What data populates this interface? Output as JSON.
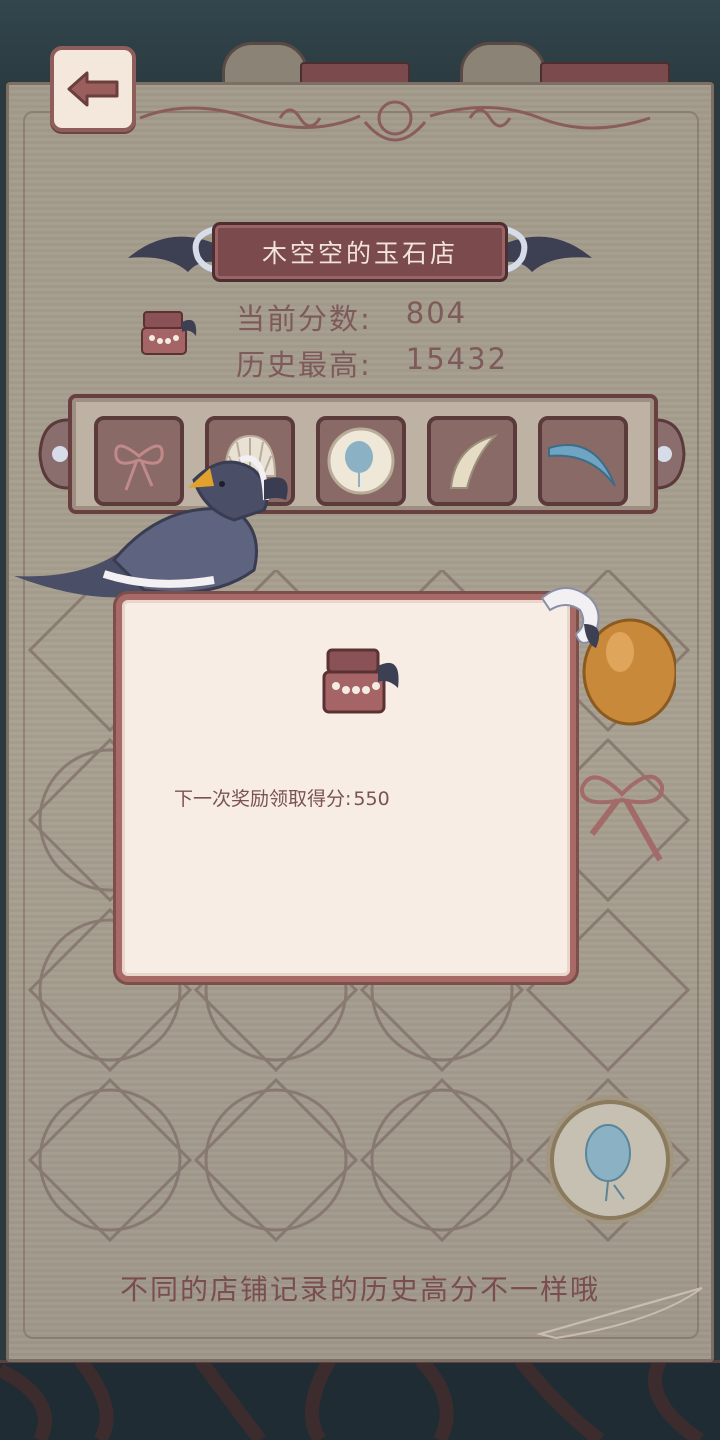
{
  "shop": {
    "title": "木空空的玉石店"
  },
  "score": {
    "current_label": "当前分数:",
    "current_value": "804",
    "best_label": "历史最高:",
    "best_value": "15432"
  },
  "collection": {
    "items": [
      {
        "name": "ribbon-bow",
        "icon": "bow-icon"
      },
      {
        "name": "seashell",
        "icon": "shell-icon"
      },
      {
        "name": "blue-egg-plate",
        "icon": "egg-plate-icon"
      },
      {
        "name": "bone-fang",
        "icon": "fang-icon"
      },
      {
        "name": "blue-feather-curve",
        "icon": "blue-crescent-icon"
      }
    ]
  },
  "dialog": {
    "reward_label": "下一次奖励领取得分:",
    "reward_value": "550"
  },
  "hint": "不同的店铺记录的历史高分不一样哦",
  "colors": {
    "panel": "#a8a090",
    "dialog_bg": "#f8ede4",
    "dialog_border": "#a86a66",
    "plate": "#7a4a4d",
    "text_brown": "#7e5a5a"
  }
}
